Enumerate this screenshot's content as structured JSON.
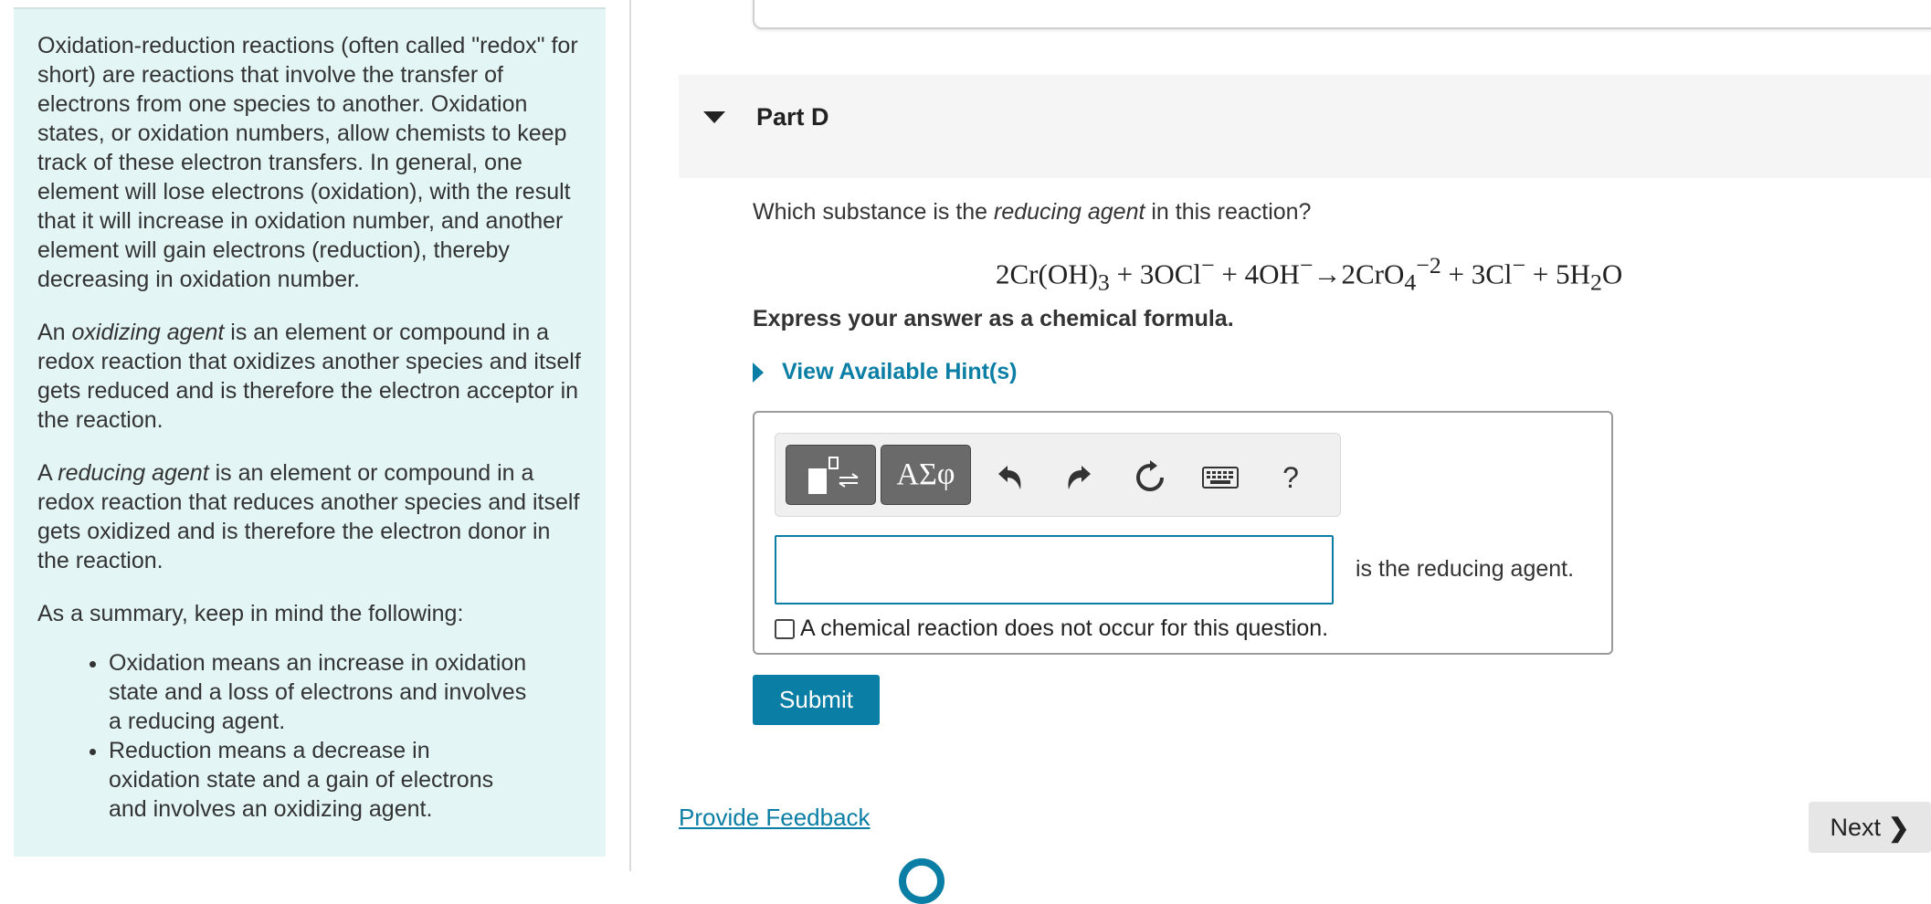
{
  "intro": {
    "paragraph1": "Oxidation-reduction reactions (often called \"redox\" for short) are reactions that involve the transfer of electrons from one species to another. Oxidation states, or oxidation numbers, allow chemists to keep track of these electron transfers. In general, one element will lose electrons (oxidation), with the result that it will increase in oxidation number, and another element will gain electrons (reduction), thereby decreasing in oxidation number.",
    "p2_prefix": "An ",
    "p2_term": "oxidizing agent",
    "p2_rest": " is an element or compound in a redox reaction that oxidizes another species and itself gets reduced and is therefore the electron acceptor in the reaction.",
    "p3_prefix": "A ",
    "p3_term": "reducing agent",
    "p3_rest": " is an element or compound in a redox reaction that reduces another species and itself gets oxidized and is therefore the electron donor in the reaction.",
    "summary_lead": "As a summary, keep in mind the following:",
    "bullets": [
      "Oxidation means an increase in oxidation state and a loss of electrons and involves a reducing agent.",
      "Reduction means a decrease in oxidation state and a gain of electrons and involves an oxidizing agent."
    ]
  },
  "part": {
    "title": "Part D",
    "question_prefix": "Which substance is the ",
    "question_term": "reducing agent",
    "question_suffix": " in this reaction?",
    "equation": {
      "t1": "2Cr(OH)",
      "s1": "3",
      "t2": " + 3OCl",
      "sup1": "−",
      "t3": " + 4OH",
      "sup2": "−",
      "t4": "→2CrO",
      "s2": "4",
      "sup3": "−2",
      "t5": " + 3Cl",
      "sup4": "−",
      "t6": " + 5H",
      "s3": "2",
      "t7": "O"
    },
    "instruction": "Express your answer as a chemical formula.",
    "hint_label": "View Available Hint(s)",
    "toolbar": {
      "greek_label": "ΑΣφ",
      "help_label": "?"
    },
    "answer_value": "",
    "answer_suffix": "is the reducing agent.",
    "no_reaction_label": "A chemical reaction does not occur for this question.",
    "submit_label": "Submit"
  },
  "footer": {
    "feedback_label": "Provide Feedback",
    "next_label": "Next"
  },
  "colors": {
    "accent": "#0a7ea4",
    "intro_bg": "#e3f5f5"
  }
}
